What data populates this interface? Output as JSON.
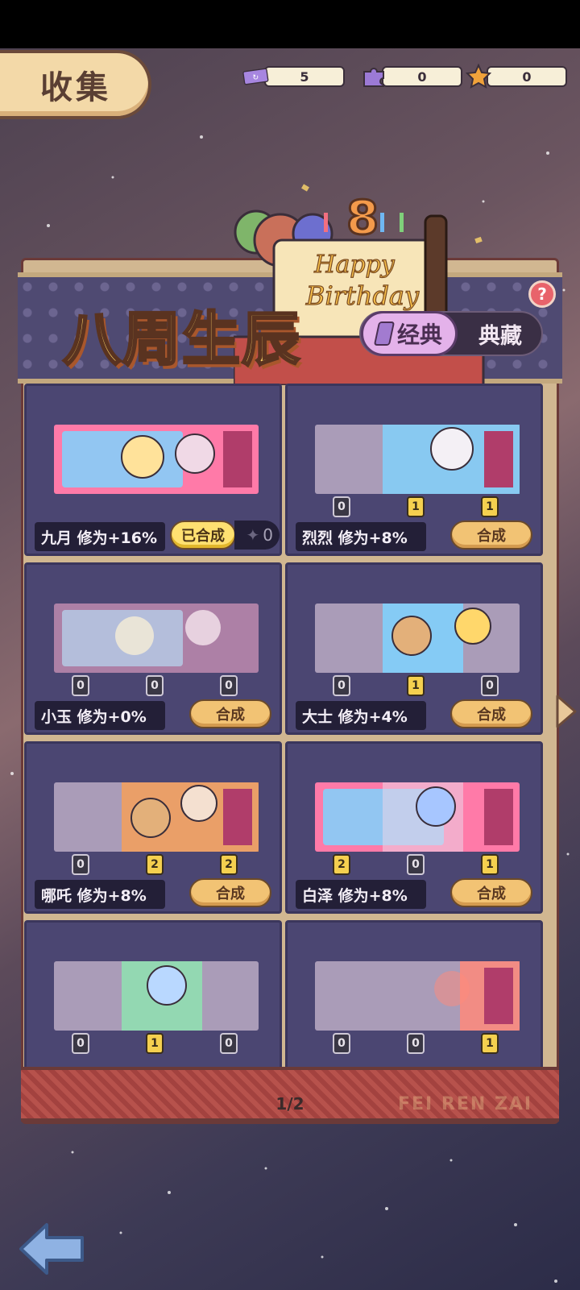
{
  "header": {
    "title": "收集",
    "currencies": [
      {
        "icon": "ticket-icon",
        "value": "5",
        "color": "#9c7ad6"
      },
      {
        "icon": "puzzle-icon",
        "value": "0",
        "color": "#9c7ad6"
      },
      {
        "icon": "star-icon",
        "value": "0",
        "color": "#f0a23b"
      }
    ]
  },
  "event": {
    "title": "八周生辰",
    "cake_text_1": "Happy",
    "cake_text_2": "Birthday",
    "cake_number": "8",
    "tabs": {
      "classic": "经典",
      "collection": "典藏"
    },
    "help": "?"
  },
  "cards": [
    {
      "name": "九月 修为+16%",
      "status": "已合成",
      "extra": "0",
      "pieces": [],
      "art_color": "#ff7aa8"
    },
    {
      "name": "烈烈 修为+8%",
      "button": "合成",
      "pieces": [
        "0",
        "1",
        "1"
      ],
      "art_color": "#7fd4ff"
    },
    {
      "name": "小玉 修为+0%",
      "button": "合成",
      "pieces": [
        "0",
        "0",
        "0"
      ],
      "art_color": "#ffb0d2"
    },
    {
      "name": "大士 修为+4%",
      "button": "合成",
      "pieces": [
        "0",
        "1",
        "0"
      ],
      "art_color": "#ffd76b"
    },
    {
      "name": "哪吒 修为+8%",
      "button": "合成",
      "pieces": [
        "0",
        "2",
        "2"
      ],
      "art_color": "#ffa04d"
    },
    {
      "name": "白泽 修为+8%",
      "button": "合成",
      "pieces": [
        "2",
        "0",
        "1"
      ],
      "art_color": "#a7c6ff"
    },
    {
      "name": "",
      "button": "",
      "pieces": [
        "0",
        "1",
        "0"
      ],
      "art_color": "#8fe3b0"
    },
    {
      "name": "",
      "button": "",
      "pieces": [
        "0",
        "0",
        "1"
      ],
      "art_color": "#ff8a7a"
    }
  ],
  "footer": {
    "page": "1/2",
    "watermark": "FEI REN ZAI"
  }
}
